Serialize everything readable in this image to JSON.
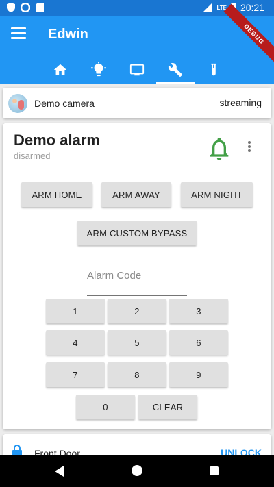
{
  "status_bar": {
    "time": "20:21",
    "network": "LTE"
  },
  "app_bar": {
    "title": "Edwin",
    "debug_label": "DEBUG"
  },
  "tabs": [
    {
      "icon": "home-icon",
      "active": false
    },
    {
      "icon": "lightbulb-icon",
      "active": false
    },
    {
      "icon": "tv-icon",
      "active": false
    },
    {
      "icon": "wrench-icon",
      "active": true
    },
    {
      "icon": "test-tube-icon",
      "active": false
    }
  ],
  "camera": {
    "name": "Demo camera",
    "state": "streaming"
  },
  "alarm": {
    "name": "Demo alarm",
    "state": "disarmed",
    "bell_color": "#43a047",
    "buttons": {
      "arm_home": "ARM HOME",
      "arm_away": "ARM AWAY",
      "arm_night": "ARM NIGHT",
      "arm_custom_bypass": "ARM CUSTOM BYPASS"
    },
    "code_placeholder": "Alarm Code",
    "keypad": {
      "k1": "1",
      "k2": "2",
      "k3": "3",
      "k4": "4",
      "k5": "5",
      "k6": "6",
      "k7": "7",
      "k8": "8",
      "k9": "9",
      "k0": "0",
      "clear": "CLEAR"
    }
  },
  "lock": {
    "name": "Front Door",
    "action": "UNLOCK"
  },
  "colors": {
    "primary": "#2196f3",
    "primary_dark": "#1976d2",
    "accent_green": "#43a047"
  }
}
